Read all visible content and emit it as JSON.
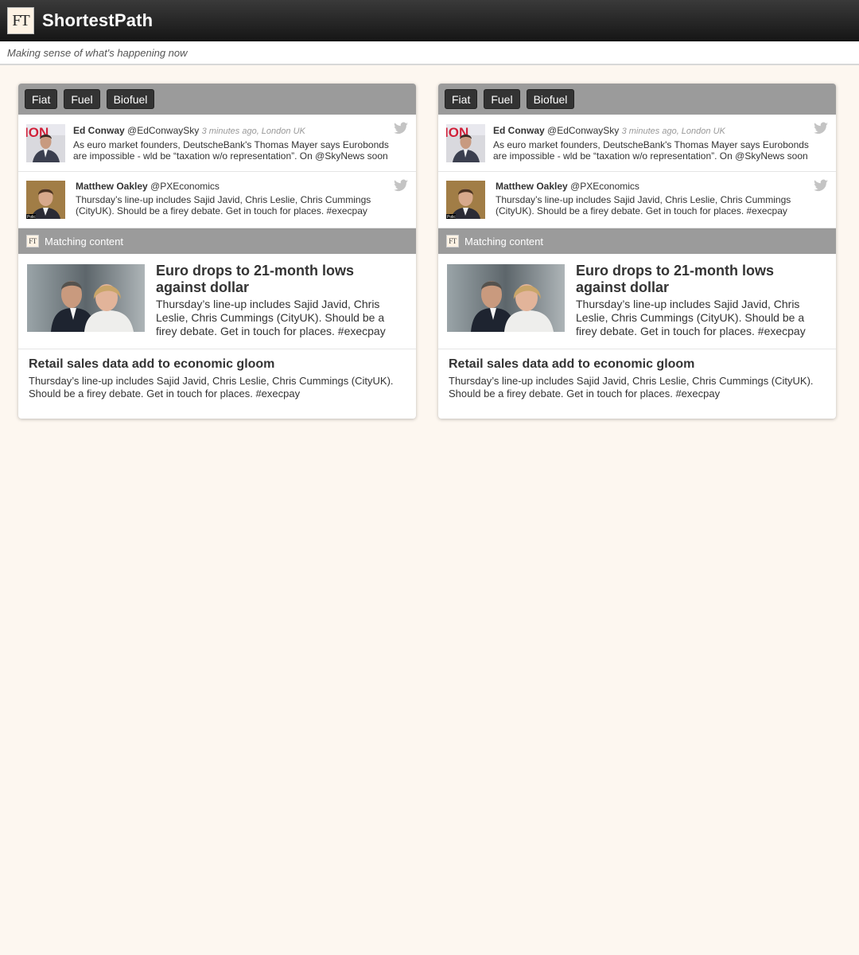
{
  "header": {
    "logo_text": "FT",
    "app_title": "ShortestPath",
    "tagline": "Making sense of what's happening now"
  },
  "cards": [
    {
      "tags": [
        "Fiat",
        "Fuel",
        "Biofuel"
      ],
      "tweets": [
        {
          "name": "Ed Conway",
          "handle": "@EdConwaySky",
          "meta": "3 minutes ago, London UK",
          "text": "As euro market founders, DeutscheBank's Thomas Mayer says Eurobonds are impossible - wld be “taxation w/o representation”. On @SkyNews soon"
        },
        {
          "name": "Matthew Oakley",
          "handle": "@PXEconomics",
          "meta": "",
          "text": "Thursday’s line-up includes Sajid Javid, Chris Leslie, Chris Cummings (CityUK). Should be a firey debate. Get in touch for places. #execpay"
        }
      ],
      "matching_label": "Matching content",
      "stories": [
        {
          "headline": "Euro drops to 21-month lows against dollar",
          "summary": "Thursday’s line-up includes Sajid Javid, Chris Leslie, Chris Cummings (CityUK). Should be a firey debate. Get in touch for places. #execpay"
        },
        {
          "headline": "Retail sales data add to economic gloom",
          "summary": "Thursday’s line-up includes Sajid Javid, Chris Leslie, Chris Cummings (CityUK). Should be a firey debate. Get in touch for places. #execpay"
        }
      ]
    },
    {
      "tags": [
        "Fiat",
        "Fuel",
        "Biofuel"
      ],
      "tweets": [
        {
          "name": "Ed Conway",
          "handle": "@EdConwaySky",
          "meta": "3 minutes ago, London UK",
          "text": "As euro market founders, DeutscheBank's Thomas Mayer says Eurobonds are impossible - wld be “taxation w/o representation”. On @SkyNews soon"
        },
        {
          "name": "Matthew Oakley",
          "handle": "@PXEconomics",
          "meta": "",
          "text": "Thursday’s line-up includes Sajid Javid, Chris Leslie, Chris Cummings (CityUK). Should be a firey debate. Get in touch for places. #execpay"
        }
      ],
      "matching_label": "Matching content",
      "stories": [
        {
          "headline": "Euro drops to 21-month lows against dollar",
          "summary": "Thursday’s line-up includes Sajid Javid, Chris Leslie, Chris Cummings (CityUK). Should be a firey debate. Get in touch for places. #execpay"
        },
        {
          "headline": "Retail sales data add to economic gloom",
          "summary": "Thursday’s line-up includes Sajid Javid, Chris Leslie, Chris Cummings (CityUK). Should be a firey debate. Get in touch for places. #execpay"
        }
      ]
    }
  ],
  "icons": {
    "logo": "ft-logo-icon",
    "tweet_source": "twitter-bird-icon"
  },
  "colors": {
    "header_bg": "#1f1f1f",
    "tag_bar": "#9b9b9b",
    "tag_chip": "#333333",
    "page_bg": "#fdf7f0"
  }
}
